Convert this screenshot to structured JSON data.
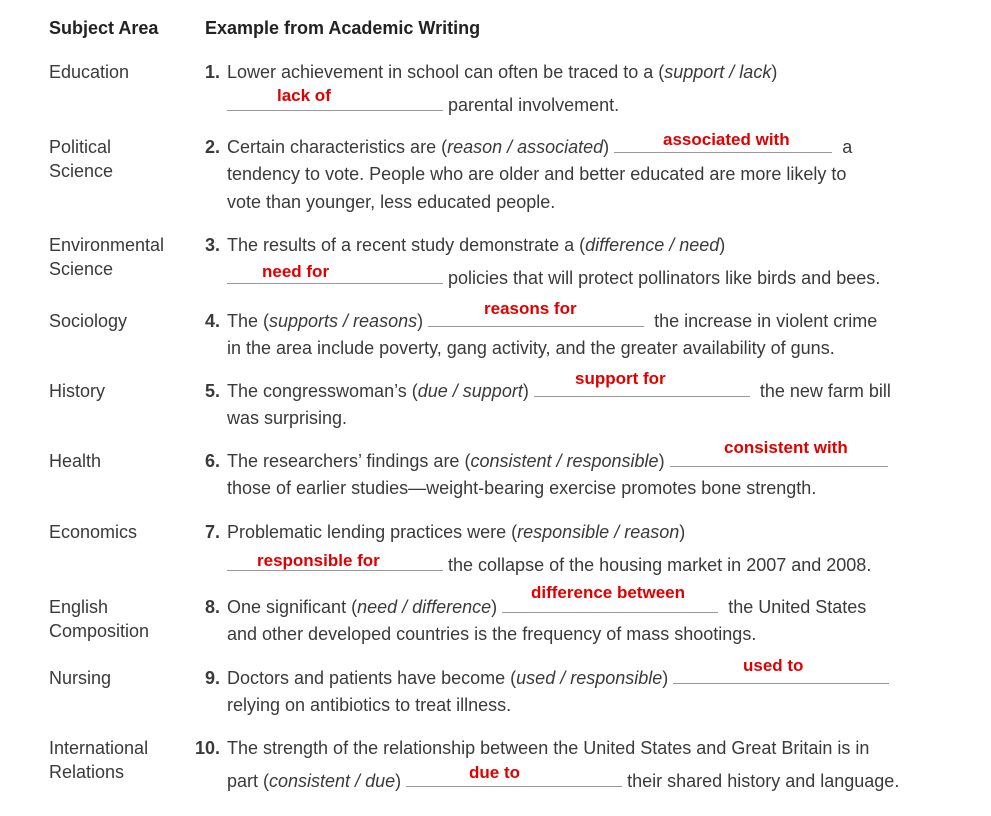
{
  "headers": {
    "subject": "Subject Area",
    "example": "Example from Academic Writing"
  },
  "rows": [
    {
      "subject": [
        "Education"
      ],
      "num": "1.",
      "l1a": "Lower achievement in school can often be traced to a (",
      "l1i": "support / lack",
      "l1b": ")",
      "l2": "parental involvement.",
      "answer": "lack of"
    },
    {
      "subject": [
        "Political",
        "Science"
      ],
      "num": "2.",
      "l1a": "Certain characteristics are (",
      "l1i": "reason / associated",
      "l1b": ")",
      "l1c": "a",
      "l2": "tendency to vote. People who are older and better educated are more likely to",
      "l3": "vote than younger, less educated people.",
      "answer": "associated with"
    },
    {
      "subject": [
        "Environmental",
        "Science"
      ],
      "num": "3.",
      "l1a": "The results of a recent study demonstrate a (",
      "l1i": "difference / need",
      "l1b": ")",
      "l2": "policies that will protect pollinators like birds and bees.",
      "answer": "need for"
    },
    {
      "subject": [
        "Sociology"
      ],
      "num": "4.",
      "l1a": "The (",
      "l1i": "supports / reasons",
      "l1b": ")",
      "l1c": "the increase in violent crime",
      "l2": "in the area include poverty, gang activity, and the greater availability of guns.",
      "answer": "reasons for"
    },
    {
      "subject": [
        "History"
      ],
      "num": "5.",
      "l1a": "The congresswoman’s (",
      "l1i": "due / support",
      "l1b": ")",
      "l1c": "the new farm bill",
      "l2": "was surprising.",
      "answer": "support for"
    },
    {
      "subject": [
        "Health"
      ],
      "num": "6.",
      "l1a": "The researchers’ findings are (",
      "l1i": "consistent / responsible",
      "l1b": ")",
      "l2": "those of earlier studies—weight-bearing exercise promotes bone strength.",
      "answer": "consistent with"
    },
    {
      "subject": [
        "Economics"
      ],
      "num": "7.",
      "l1a": "Problematic lending practices were (",
      "l1i": "responsible / reason",
      "l1b": ")",
      "l2": "the collapse of the housing market in 2007 and 2008.",
      "answer": "responsible for"
    },
    {
      "subject": [
        "English",
        "Composition"
      ],
      "num": "8.",
      "l1a": "One significant (",
      "l1i": "need / difference",
      "l1b": ")",
      "l1c": "the United States",
      "l2": "and other developed countries is the frequency of mass shootings.",
      "answer": "difference between"
    },
    {
      "subject": [
        "Nursing"
      ],
      "num": "9.",
      "l1a": "Doctors and patients have become (",
      "l1i": "used / responsible",
      "l1b": ")",
      "l2": "relying on antibiotics to treat illness.",
      "answer": "used to"
    },
    {
      "subject": [
        "International",
        "Relations"
      ],
      "num": "10.",
      "l1a": "The strength of the relationship between the United States and Great Britain is in",
      "l2a": "part (",
      "l2i": "consistent / due",
      "l2b": ")",
      "l2c": "their shared history and language.",
      "answer": "due to"
    }
  ]
}
